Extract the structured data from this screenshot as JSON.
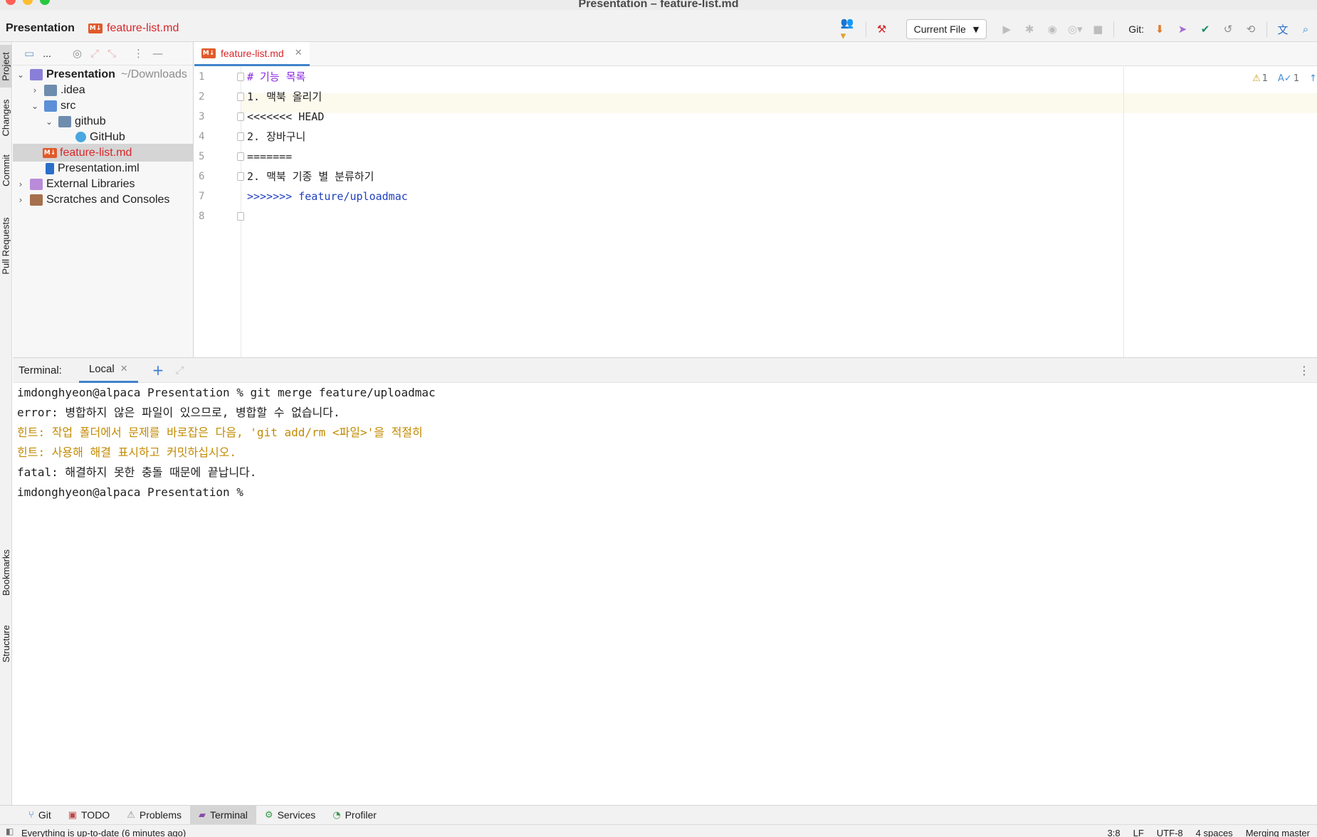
{
  "window": {
    "title": "Presentation – feature-list.md"
  },
  "navbar": {
    "project": "Presentation",
    "file": "feature-list.md",
    "run_config": "Current File",
    "git_label": "Git:"
  },
  "left_strip": {
    "tabs": [
      "Project",
      "Changes",
      "Commit",
      "Pull Requests",
      "Bookmarks",
      "Structure"
    ]
  },
  "project_tree": {
    "toolbar_label": "...",
    "items": [
      {
        "label": "Presentation",
        "hint": "~/Downloads",
        "icon": "project-folder-icon"
      },
      {
        "label": ".idea",
        "icon": "folder-icon"
      },
      {
        "label": "src",
        "icon": "source-folder-icon"
      },
      {
        "label": "github",
        "icon": "package-folder-icon"
      },
      {
        "label": "GitHub",
        "icon": "class-icon"
      },
      {
        "label": "feature-list.md",
        "icon": "markdown-icon"
      },
      {
        "label": "Presentation.iml",
        "icon": "iml-icon"
      },
      {
        "label": "External Libraries",
        "icon": "library-icon"
      },
      {
        "label": "Scratches and Consoles",
        "icon": "scratch-icon"
      }
    ]
  },
  "editor": {
    "tab": "feature-list.md",
    "inspections": {
      "warnings": "1",
      "typos": "1"
    },
    "lines": [
      {
        "num": "1",
        "text": "# 기능 목록"
      },
      {
        "num": "2",
        "text": "1. 맥북 올리기"
      },
      {
        "num": "3",
        "text": "<<<<<<< HEAD"
      },
      {
        "num": "4",
        "text": "2. 장바구니"
      },
      {
        "num": "5",
        "text": "======="
      },
      {
        "num": "6",
        "text": "2. 맥북 기종 별 분류하기"
      },
      {
        "num": "7",
        "text": ">>>>>>> feature/uploadmac"
      },
      {
        "num": "8",
        "text": ""
      }
    ]
  },
  "terminal": {
    "label": "Terminal:",
    "tab": "Local",
    "lines": [
      "imdonghyeon@alpaca Presentation % git merge feature/uploadmac",
      "error: 병합하지 않은 파일이 있으므로, 병합할 수 없습니다.",
      "힌트: 작업 폴더에서 문제를 바로잡은 다음, 'git add/rm <파일>'을 적절히",
      "힌트: 사용해 해결 표시하고 커밋하십시오.",
      "fatal: 해결하지 못한 충돌 때문에 끝납니다.",
      "imdonghyeon@alpaca Presentation %"
    ]
  },
  "bottom_tools": [
    "Git",
    "TODO",
    "Problems",
    "Terminal",
    "Services",
    "Profiler"
  ],
  "status": {
    "message": "Everything is up-to-date (6 minutes ago)",
    "position": "3:8",
    "line_sep": "LF",
    "encoding": "UTF-8",
    "indent": "4 spaces",
    "vcs": "Merging master"
  },
  "colors": {
    "accent": "#4083c9",
    "modified_file": "#d8262a",
    "hint": "#c28a00",
    "heading": "#8a2be2",
    "list_number": "#1f3fbf",
    "conflict_marker": "#2040c0",
    "branch": "#178c00"
  }
}
